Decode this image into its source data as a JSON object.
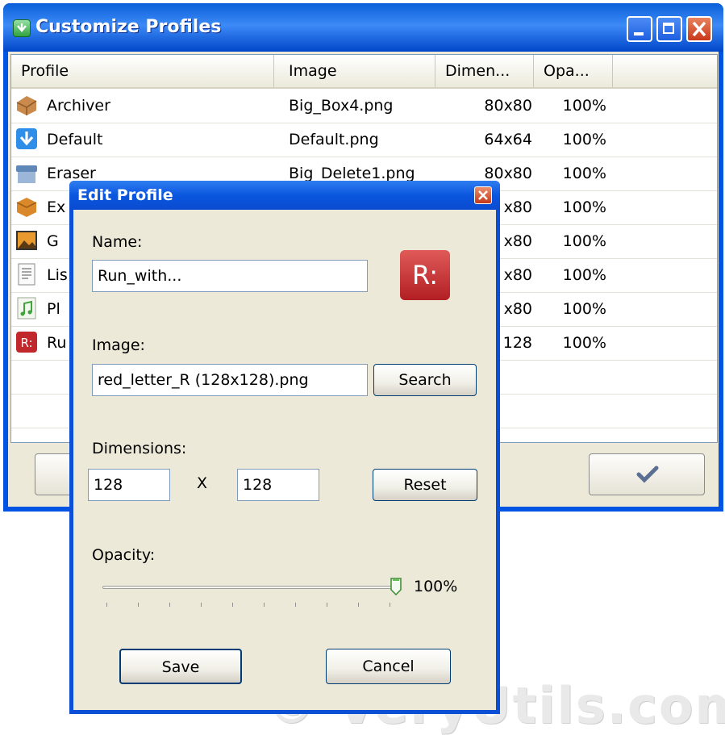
{
  "main_window": {
    "title": "Customize Profiles",
    "columns": [
      "Profile",
      "Image",
      "Dimen...",
      "Opa..."
    ],
    "rows": [
      {
        "name": "Archiver",
        "image": "Big_Box4.png",
        "dimensions": "80x80",
        "opacity": "100%",
        "icon": "box-icon"
      },
      {
        "name": "Default",
        "image": "Default.png",
        "dimensions": "64x64",
        "opacity": "100%",
        "icon": "download-arrow-icon"
      },
      {
        "name": "Eraser",
        "image": "Big_Delete1.png",
        "dimensions": "80x80",
        "opacity": "100%",
        "icon": "trash-icon"
      },
      {
        "name": "Ex",
        "image": "",
        "dimensions": "x80",
        "opacity": "100%",
        "icon": "package-icon"
      },
      {
        "name": "G",
        "image": "",
        "dimensions": "x80",
        "opacity": "100%",
        "icon": "picture-icon"
      },
      {
        "name": "Lis",
        "image": "",
        "dimensions": "x80",
        "opacity": "100%",
        "icon": "document-icon"
      },
      {
        "name": "Pl",
        "image": "",
        "dimensions": "x80",
        "opacity": "100%",
        "icon": "music-note-icon"
      },
      {
        "name": "Ru",
        "image": "",
        "dimensions": "128",
        "opacity": "100%",
        "icon": "red-letter-r-icon"
      }
    ],
    "ok_icon": "checkmark-icon"
  },
  "dialog": {
    "title": "Edit Profile",
    "name_label": "Name:",
    "name_value": "Run_with...",
    "preview_icon_text": "R:",
    "image_label": "Image:",
    "image_value": "red_letter_R (128x128).png",
    "search_label": "Search",
    "dimensions_label": "Dimensions:",
    "width_value": "128",
    "x_separator": "X",
    "height_value": "128",
    "reset_label": "Reset",
    "opacity_label": "Opacity:",
    "opacity_value": "100%",
    "opacity_fraction": 1.0,
    "save_label": "Save",
    "cancel_label": "Cancel"
  },
  "watermark": "© VeryUtils.com",
  "colors": {
    "titlebar_blue": "#0054e3",
    "dialog_bg": "#ece9d8",
    "close_red": "#c8391a",
    "r_icon_red": "#c0282b"
  }
}
